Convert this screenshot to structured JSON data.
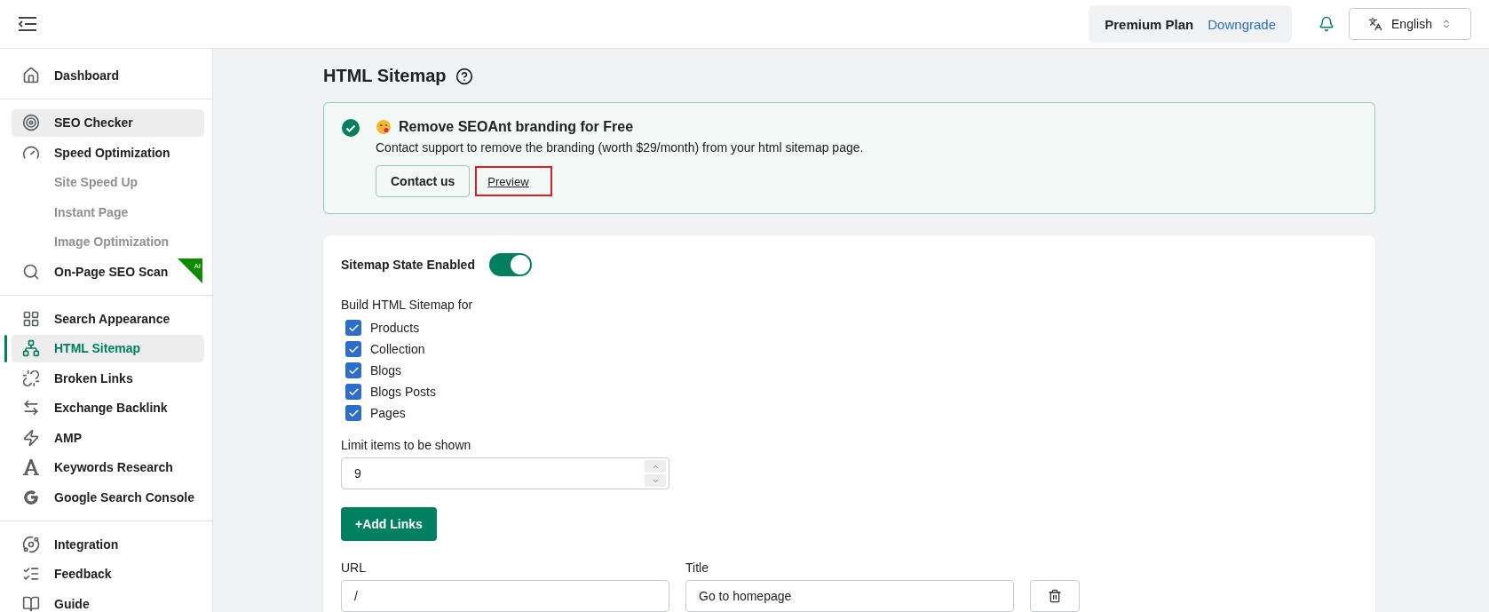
{
  "header": {
    "plan": "Premium Plan",
    "downgrade": "Downgrade",
    "language": "English"
  },
  "sidebar": {
    "sections": [
      [
        {
          "label": "Dashboard",
          "kind": "main",
          "selected": false,
          "hovered": false
        }
      ],
      [
        {
          "label": "SEO Checker",
          "kind": "main",
          "selected": false,
          "hovered": true
        },
        {
          "label": "Speed Optimization",
          "kind": "main",
          "selected": false,
          "hovered": false
        },
        {
          "label": "Site Speed Up",
          "kind": "sub",
          "selected": false,
          "hovered": false
        },
        {
          "label": "Instant Page",
          "kind": "sub",
          "selected": false,
          "hovered": false
        },
        {
          "label": "Image Optimization",
          "kind": "sub",
          "selected": false,
          "hovered": false
        },
        {
          "label": "On-Page SEO Scan",
          "kind": "main",
          "selected": false,
          "hovered": false,
          "badge": "AI"
        }
      ],
      [
        {
          "label": "Search Appearance",
          "kind": "main",
          "selected": false,
          "hovered": false
        },
        {
          "label": "HTML Sitemap",
          "kind": "main",
          "selected": true,
          "hovered": false
        },
        {
          "label": "Broken Links",
          "kind": "main",
          "selected": false,
          "hovered": false
        },
        {
          "label": "Exchange Backlink",
          "kind": "main",
          "selected": false,
          "hovered": false
        },
        {
          "label": "AMP",
          "kind": "main",
          "selected": false,
          "hovered": false
        },
        {
          "label": "Keywords Research",
          "kind": "main",
          "selected": false,
          "hovered": false
        },
        {
          "label": "Google Search Console",
          "kind": "main",
          "selected": false,
          "hovered": false
        }
      ],
      [
        {
          "label": "Integration",
          "kind": "main",
          "selected": false,
          "hovered": false
        },
        {
          "label": "Feedback",
          "kind": "main",
          "selected": false,
          "hovered": false
        },
        {
          "label": "Guide",
          "kind": "main",
          "selected": false,
          "hovered": false
        }
      ]
    ]
  },
  "page_title": "HTML Sitemap",
  "banner": {
    "title": "Remove SEOAnt branding for Free",
    "text": "Contact support to remove the branding (worth $29/month) from your html sitemap page.",
    "button": "Contact us",
    "link": "Preview"
  },
  "settings": {
    "state_label": "Sitemap State Enabled",
    "enabled": true,
    "build_label": "Build HTML Sitemap for",
    "options": [
      {
        "label": "Products",
        "checked": true
      },
      {
        "label": "Collection",
        "checked": true
      },
      {
        "label": "Blogs",
        "checked": true
      },
      {
        "label": "Blogs Posts",
        "checked": true
      },
      {
        "label": "Pages",
        "checked": true
      }
    ],
    "limit_label": "Limit items to be shown",
    "limit_value": "9",
    "add_button": "+Add Links",
    "link_columns": [
      "URL",
      "Title"
    ],
    "links": [
      {
        "url": "/",
        "title": "Go to homepage"
      }
    ]
  }
}
